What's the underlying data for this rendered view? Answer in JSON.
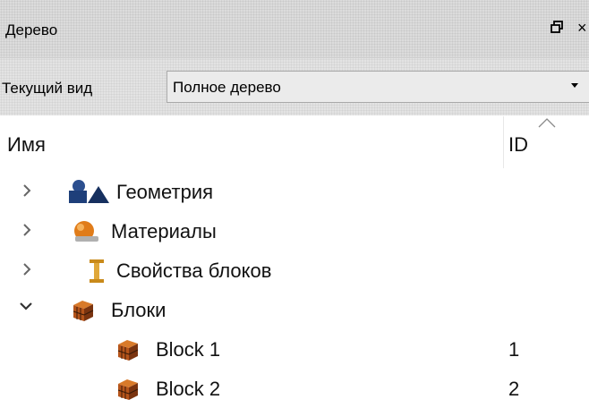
{
  "panel": {
    "title": "Дерево",
    "float_glyph": "⊡",
    "close_glyph": "×"
  },
  "view": {
    "label": "Текущий вид",
    "selected": "Полное дерево"
  },
  "tree": {
    "columns": {
      "name": "Имя",
      "id": "ID"
    },
    "items": [
      {
        "label": "Геометрия",
        "id": "",
        "expanded": false,
        "icon": "geometry-icon"
      },
      {
        "label": "Материалы",
        "id": "",
        "expanded": false,
        "icon": "materials-icon"
      },
      {
        "label": "Свойства блоков",
        "id": "",
        "expanded": false,
        "icon": "block-properties-icon"
      },
      {
        "label": "Блоки",
        "id": "",
        "expanded": true,
        "icon": "blocks-icon",
        "children": [
          {
            "label": "Block 1",
            "id": "1",
            "icon": "block-icon"
          },
          {
            "label": "Block 2",
            "id": "2",
            "icon": "block-icon"
          }
        ]
      }
    ]
  },
  "colors": {
    "geometry": "#1e3f7a",
    "materials": "#e07c1a",
    "block_properties": "#c98a1a",
    "blocks": "#b5541a"
  }
}
